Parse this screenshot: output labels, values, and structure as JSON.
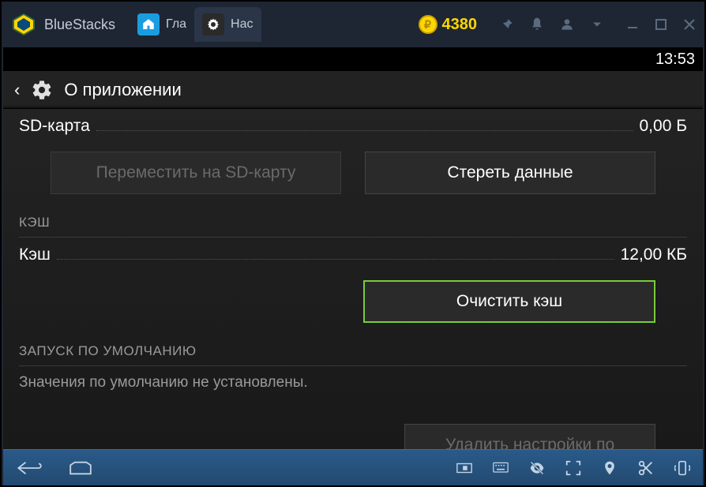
{
  "titlebar": {
    "app_name": "BlueStacks",
    "tabs": [
      {
        "label": "Гла"
      },
      {
        "label": "Нас"
      }
    ],
    "coins": "4380"
  },
  "status": {
    "time": "13:53"
  },
  "header": {
    "title": "О приложении"
  },
  "content": {
    "sd_label": "SD-карта",
    "sd_value": "0,00 Б",
    "move_sd_button": "Переместить на SD-карту",
    "clear_data_button": "Стереть данные",
    "cache_section": "КЭШ",
    "cache_label": "Кэш",
    "cache_value": "12,00 КБ",
    "clear_cache_button": "Очистить кэш",
    "launch_section": "ЗАПУСК ПО УМОЛЧАНИЮ",
    "launch_text": "Значения по умолчанию не установлены.",
    "partial_button": "Удалить настройки по"
  }
}
